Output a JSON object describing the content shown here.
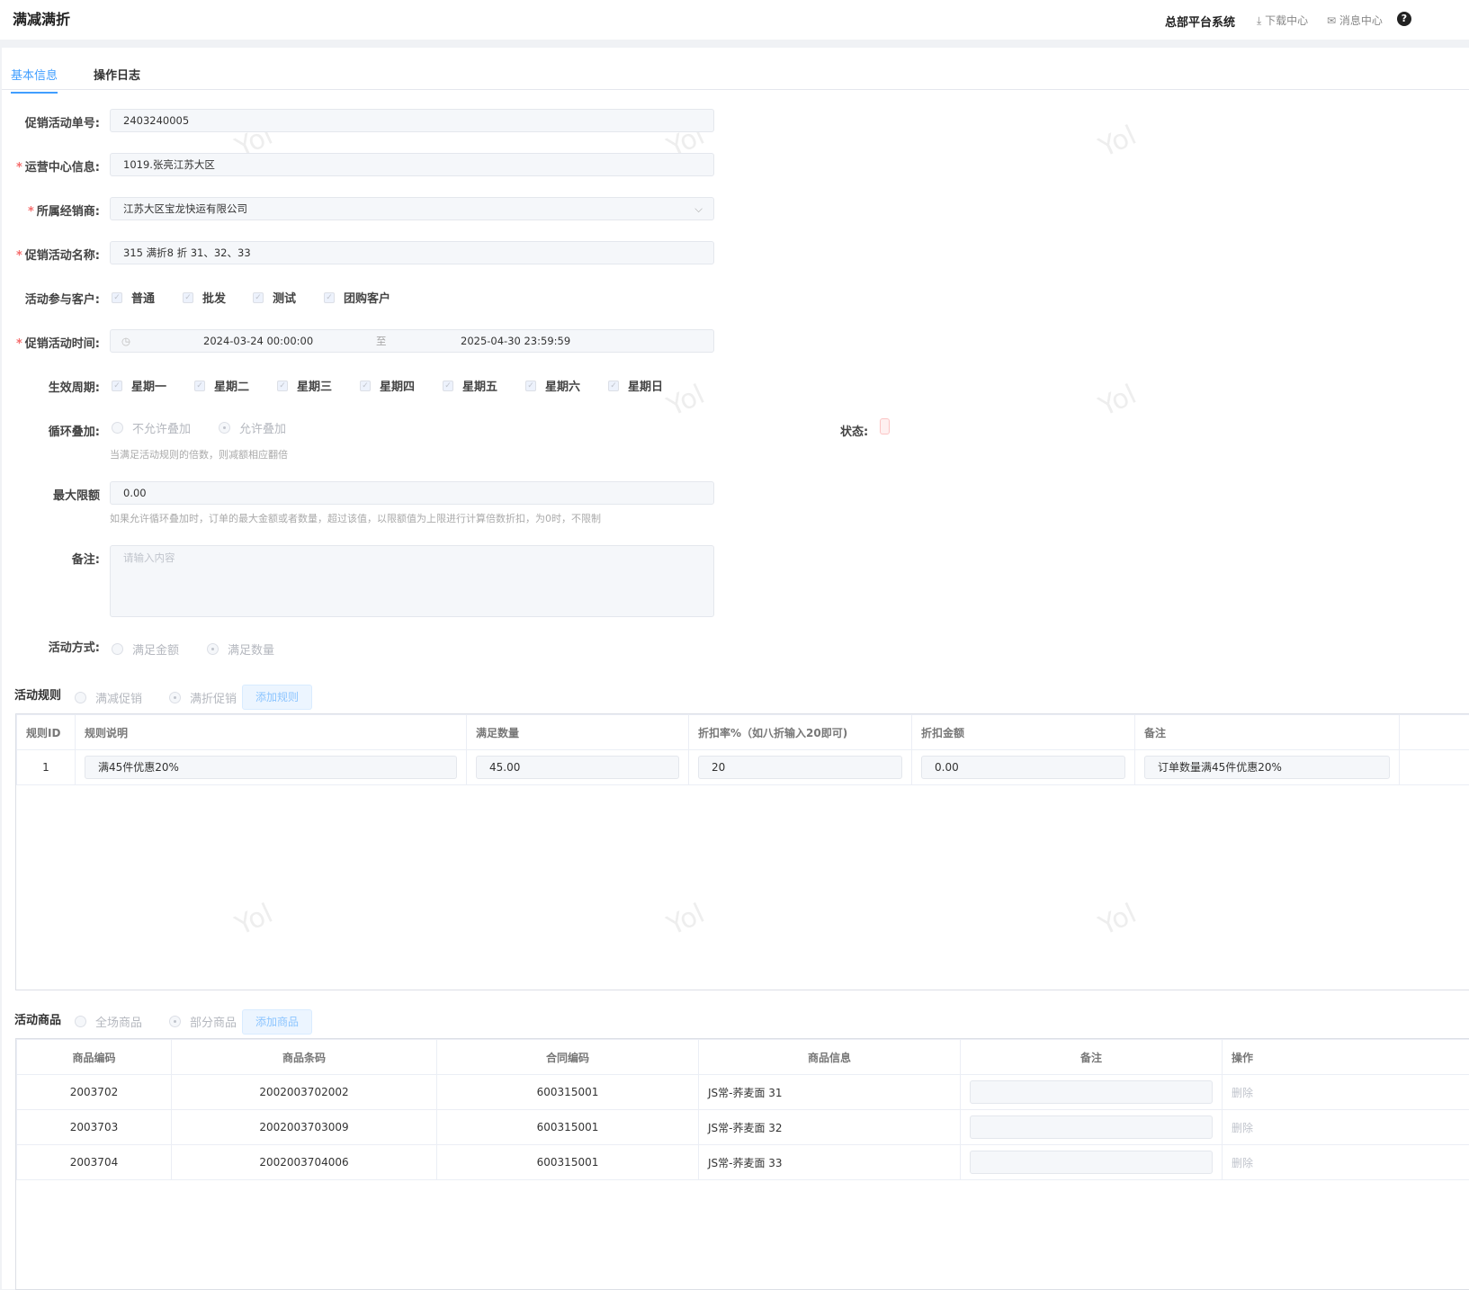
{
  "header": {
    "title": "满减满折",
    "system": "总部平台系统",
    "download": "下载中心",
    "message": "消息中心",
    "help": "?"
  },
  "tabs": [
    {
      "label": "基本信息"
    },
    {
      "label": "操作日志"
    }
  ],
  "form": {
    "order_no_label": "促销活动单号:",
    "order_no": "2403240005",
    "center_label": "运营中心信息:",
    "center": "1019.张亮江苏大区",
    "dealer_label": "所属经销商:",
    "dealer": "江苏大区宝龙快运有限公司",
    "name_label": "促销活动名称:",
    "name": "315 满折8 折 31、32、33",
    "customers_label": "活动参与客户:",
    "customers": [
      "普通",
      "批发",
      "测试",
      "团购客户"
    ],
    "time_label": "促销活动时间:",
    "start": "2024-03-24 00:00:00",
    "sep": "至",
    "end": "2025-04-30 23:59:59",
    "cycle_label": "生效周期:",
    "weekdays": [
      "星期一",
      "星期二",
      "星期三",
      "星期四",
      "星期五",
      "星期六",
      "星期日"
    ],
    "loop_label": "循环叠加:",
    "loop_options": [
      "不允许叠加",
      "允许叠加"
    ],
    "loop_hint": "当满足活动规则的倍数，则减额相应翻倍",
    "status_label": "状态:",
    "max_label": "最大限额",
    "max": "0.00",
    "max_hint": "如果允许循环叠加时，订单的最大金额或者数量，超过该值，以限额值为上限进行计算倍数折扣，为0时，不限制",
    "remark_label": "备注:",
    "remark_placeholder": "请输入内容",
    "mode_label": "活动方式:",
    "mode_options": [
      "满足金额",
      "满足数量"
    ]
  },
  "rules": {
    "title": "活动规则",
    "options": [
      "满减促销",
      "满折促销"
    ],
    "add": "添加规则",
    "headers": [
      "规则ID",
      "规则说明",
      "满足数量",
      "折扣率%（如八折输入20即可)",
      "折扣金额",
      "备注"
    ],
    "rows": [
      [
        "1",
        "满45件优惠20%",
        "45.00",
        "20",
        "0.00",
        "订单数量满45件优惠20%"
      ]
    ]
  },
  "products": {
    "title": "活动商品",
    "options": [
      "全场商品",
      "部分商品"
    ],
    "add": "添加商品",
    "headers": [
      "商品编码",
      "商品条码",
      "合同编码",
      "商品信息",
      "备注",
      "操作"
    ],
    "rows": [
      [
        "2003702",
        "2002003702002",
        "600315001",
        "JS常-荞麦面 31",
        "",
        "删除"
      ],
      [
        "2003703",
        "2002003703009",
        "600315001",
        "JS常-荞麦面 32",
        "",
        "删除"
      ],
      [
        "2003704",
        "2002003704006",
        "600315001",
        "JS常-荞麦面 33",
        "",
        "删除"
      ]
    ]
  }
}
